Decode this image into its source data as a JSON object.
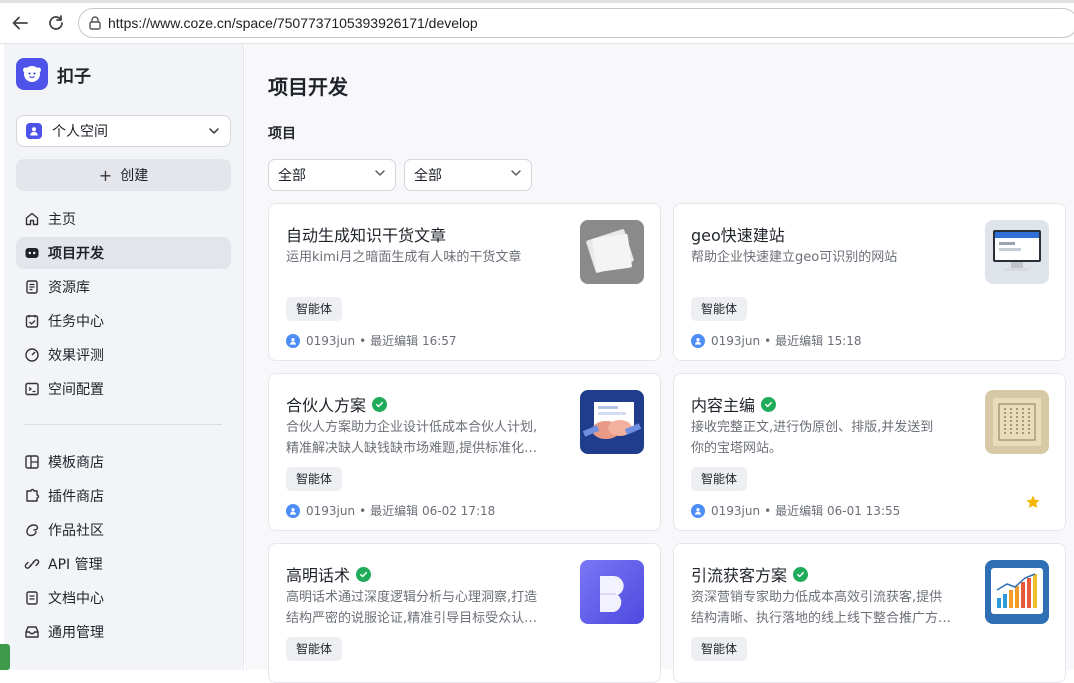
{
  "browser": {
    "url": "https://www.coze.cn/space/7507737105393926171/develop"
  },
  "sidebar": {
    "brand": "扣子",
    "space": "个人空间",
    "create_label": "创建",
    "items": [
      {
        "label": "主页",
        "icon": "home-icon"
      },
      {
        "label": "项目开发",
        "icon": "bot-icon",
        "active": true
      },
      {
        "label": "资源库",
        "icon": "library-icon"
      },
      {
        "label": "任务中心",
        "icon": "task-icon"
      },
      {
        "label": "效果评测",
        "icon": "gauge-icon"
      },
      {
        "label": "空间配置",
        "icon": "terminal-icon"
      }
    ],
    "items2": [
      {
        "label": "模板商店",
        "icon": "template-icon"
      },
      {
        "label": "插件商店",
        "icon": "plugin-icon"
      },
      {
        "label": "作品社区",
        "icon": "community-icon"
      },
      {
        "label": "API 管理",
        "icon": "link-icon"
      },
      {
        "label": "文档中心",
        "icon": "doc-icon"
      },
      {
        "label": "通用管理",
        "icon": "inbox-icon"
      }
    ]
  },
  "main": {
    "title": "项目开发",
    "section": "项目",
    "filters": [
      "全部",
      "全部"
    ],
    "cards": [
      {
        "title": "自动生成知识干货文章",
        "verified": false,
        "desc1": "运用kimi月之暗面生成有人味的干货文章",
        "desc2": "",
        "tag": "智能体",
        "author": "0193jun",
        "edited": "最近编辑 16:57",
        "starred": false
      },
      {
        "title": "geo快速建站",
        "verified": false,
        "desc1": "帮助企业快速建立geo可识别的网站",
        "desc2": "",
        "tag": "智能体",
        "author": "0193jun",
        "edited": "最近编辑 15:18",
        "starred": false
      },
      {
        "title": "合伙人方案",
        "verified": true,
        "desc1": "合伙人方案助力企业设计低成本合伙人计划,",
        "desc2": "精准解决缺人缺钱缺市场难题,提供标准化…",
        "tag": "智能体",
        "author": "0193jun",
        "edited": "最近编辑 06-02 17:18",
        "starred": false
      },
      {
        "title": "内容主编",
        "verified": true,
        "desc1": "接收完整正文,进行伪原创、排版,并发送到",
        "desc2": "你的宝塔网站。",
        "tag": "智能体",
        "author": "0193jun",
        "edited": "最近编辑 06-01 13:55",
        "starred": true
      },
      {
        "title": "高明话术",
        "verified": true,
        "desc1": "高明话术通过深度逻辑分析与心理洞察,打造",
        "desc2": "结构严密的说服论证,精准引导目标受众认…",
        "tag": "智能体",
        "author": "",
        "edited": "",
        "starred": false
      },
      {
        "title": "引流获客方案",
        "verified": true,
        "desc1": "资深营销专家助力低成本高效引流获客,提供",
        "desc2": "结构清晰、执行落地的线上线下整合推广方…",
        "tag": "智能体",
        "author": "",
        "edited": "",
        "starred": false
      }
    ]
  },
  "meta_separator": "•",
  "colors": {
    "accent": "#4d53e8",
    "verified": "#1fab5a",
    "star": "#f2b600"
  }
}
